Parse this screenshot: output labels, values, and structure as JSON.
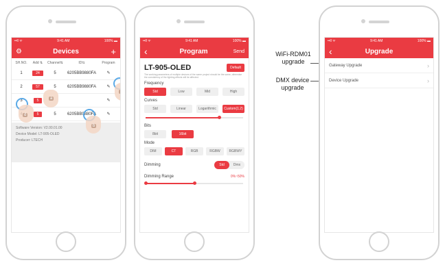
{
  "status": {
    "time": "9:41 AM",
    "signal": "••ll ᯤ",
    "battery": "100% ▬"
  },
  "devices": {
    "title": "Devices",
    "columns": [
      "SH.NO.",
      "Add ⇅",
      "Channel⇅",
      "ID⇅",
      "Program"
    ],
    "rows": [
      {
        "no": "1",
        "add": "24",
        "ch": "5",
        "id": "6205BB9880FA"
      },
      {
        "no": "2",
        "add": "57",
        "ch": "5",
        "id": "6205BB9880FA"
      },
      {
        "no": "3",
        "add": "5",
        "ch": "",
        "id": ""
      },
      {
        "no": "4",
        "add": "5",
        "ch": "5",
        "id": "6205BB9880FA"
      }
    ],
    "info": {
      "software": "Software Version: V2.00.01.00",
      "model": "Device Model: LT-905-OLED",
      "producer": "Producer: LTECH"
    },
    "hand_letters": [
      "a",
      "c",
      "b",
      "d"
    ]
  },
  "program": {
    "back": "‹",
    "title": "Program",
    "send": "Send",
    "device": "LT-905-OLED",
    "default_btn": "Default",
    "note": "The working parameters of multiple devices of the same project should be the same, otherwise the consistency of the lighting effects will be affected.",
    "frequency_label": "Frequency",
    "frequency": [
      "Std",
      "Low",
      "Mid",
      "High"
    ],
    "frequency_selected": 0,
    "curves_label": "Curves",
    "curves": [
      "Std",
      "Linear",
      "Logarithmic",
      "Custom(1.2)"
    ],
    "curves_selected": 3,
    "curve_slider": 0.75,
    "bits_label": "Bits",
    "bits": [
      "8bit",
      "16bit"
    ],
    "bits_selected": 1,
    "mode_label": "Mode",
    "mode": [
      "DIM",
      "CT",
      "RGB",
      "RGBW",
      "RGBWY"
    ],
    "mode_selected": 1,
    "dimming_label": "Dimming",
    "dimming": [
      "Std",
      "Dmx"
    ],
    "dimming_selected": 0,
    "range_label": "Dimming Range",
    "range_value": "0%~50%",
    "range_fraction": 0.5
  },
  "upgrade": {
    "back": "‹",
    "title": "Upgrade",
    "items": [
      "Gateway Upgrade",
      "Device Upgrade"
    ]
  },
  "callouts": {
    "wifi": "WiFi-RDM01\nupgrade",
    "dmx": "DMX device\nupgrade"
  },
  "colors": {
    "accent": "#ea3b42",
    "hand": "#f3d6c4",
    "ring": "#5aa9e6"
  }
}
